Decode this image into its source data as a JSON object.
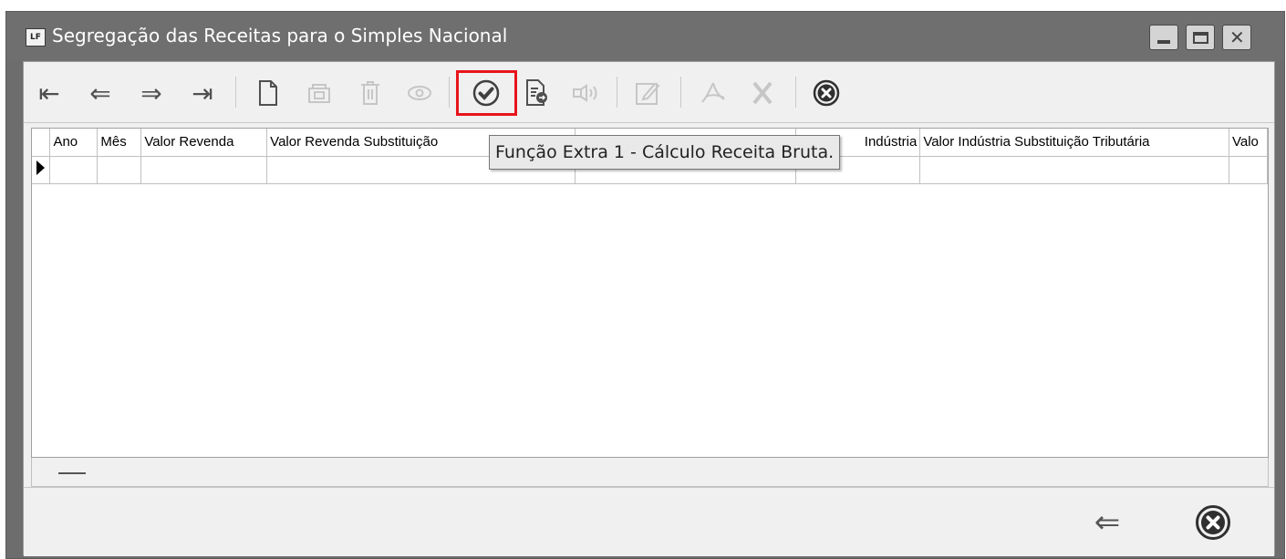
{
  "window": {
    "app_icon_label": "LF",
    "title": "Segregação das Receitas para o Simples Nacional",
    "min_glyph": "",
    "max_glyph": "",
    "close_glyph": "✕"
  },
  "toolbar": {
    "first": "⇤",
    "prev": "⇐",
    "next": "⇒",
    "last": "⇥",
    "new_icon": "document-icon",
    "copy_icon": "copy-icon",
    "delete_icon": "trash-icon",
    "view_icon": "eye-icon",
    "extra_function_icon": "check-circle-icon",
    "report_icon": "report-icon",
    "audio_icon": "speaker-icon",
    "edit_icon": "edit-icon",
    "pdf_icon": "pdf-icon",
    "excel_icon": "excel-icon",
    "close_icon": "close-circle-icon",
    "highlight_color": "#e8141b"
  },
  "grid": {
    "columns": [
      "",
      "Ano",
      "Mês",
      "Valor Revenda",
      "Valor Revenda Substituição",
      "",
      "Indústria",
      "Valor Indústria Substituição Tributária",
      "Valo"
    ],
    "rows": [
      [
        "",
        "",
        "",
        "",
        "",
        "",
        "",
        "",
        ""
      ]
    ]
  },
  "tooltip": {
    "text": "Função Extra 1 - Cálculo Receita Bruta."
  },
  "footer": {
    "back_glyph": "⇐",
    "close_icon": "close-circle-icon"
  }
}
